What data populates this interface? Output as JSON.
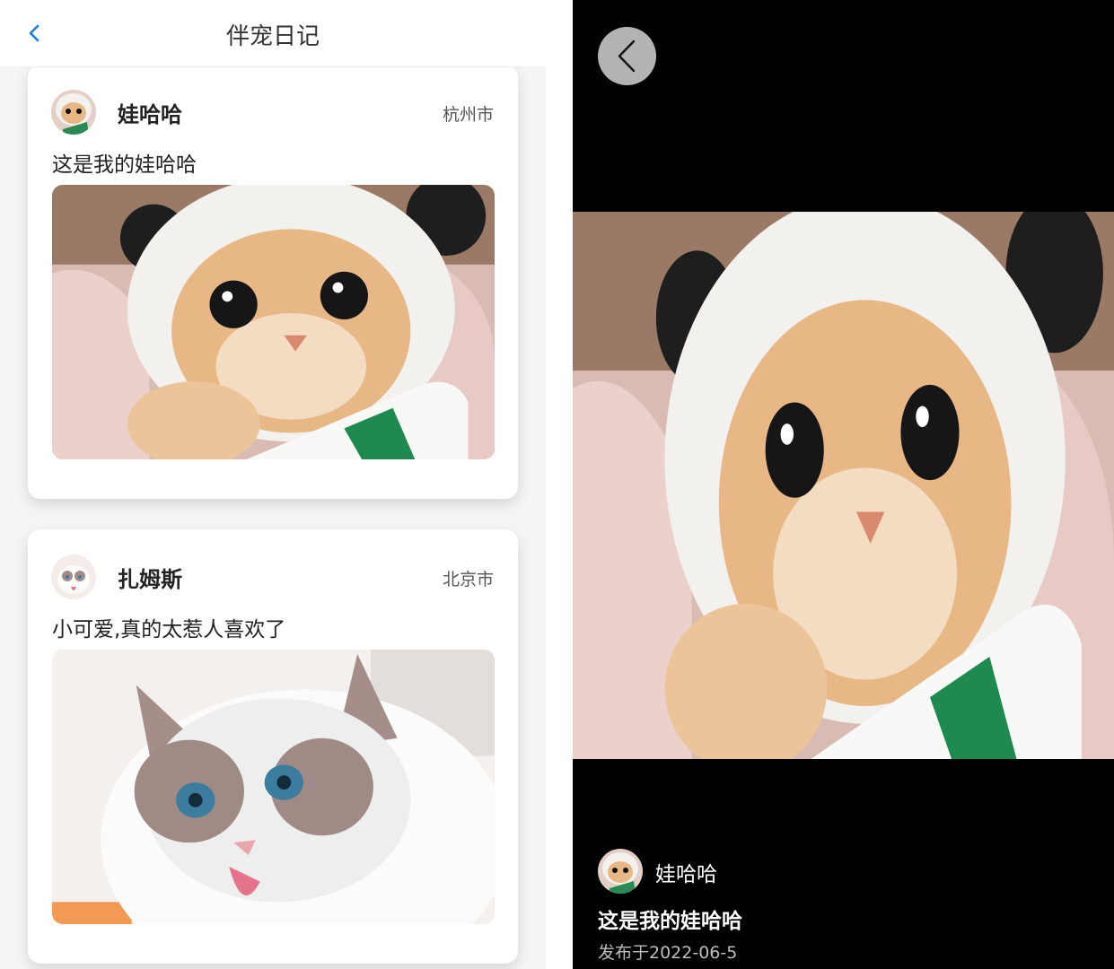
{
  "nav": {
    "title": "伴宠日记",
    "back_icon": "chevron-left-icon",
    "accent": "#1e7be0"
  },
  "posts": [
    {
      "user": "娃哈哈",
      "city": "杭州市",
      "text": "这是我的娃哈哈",
      "image": "kitten-panda-hat-photo"
    },
    {
      "user": "扎姆斯",
      "city": "北京市",
      "text": "小可爱,真的太惹人喜欢了",
      "image": "ragdoll-cat-photo"
    }
  ],
  "detail": {
    "back_icon": "chevron-left-icon",
    "user": "娃哈哈",
    "text": "这是我的娃哈哈",
    "date": "发布于2022-06-5",
    "image": "kitten-panda-hat-photo"
  }
}
